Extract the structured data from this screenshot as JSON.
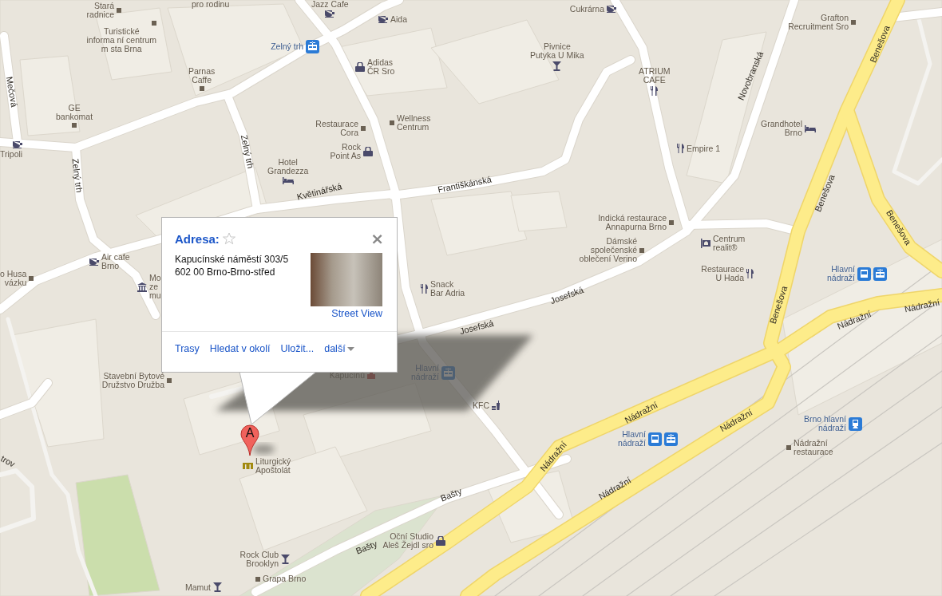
{
  "map": {
    "streets": [
      {
        "text": "Mečová"
      },
      {
        "text": "Zelný trh"
      },
      {
        "text": "Zelný trh"
      },
      {
        "text": "Květinářská"
      },
      {
        "text": "Františkánská"
      },
      {
        "text": "Novobranská"
      },
      {
        "text": "Benešova"
      },
      {
        "text": "Benešova"
      },
      {
        "text": "Benešova"
      },
      {
        "text": "Benešova"
      },
      {
        "text": "Josefská"
      },
      {
        "text": "Josefská"
      },
      {
        "text": "Nádražní"
      },
      {
        "text": "Nádražní"
      },
      {
        "text": "Nádražní"
      },
      {
        "text": "Nádražní"
      },
      {
        "text": "Nádražní"
      },
      {
        "text": "Nádražní"
      },
      {
        "text": "Bašty"
      },
      {
        "text": "Bašty"
      },
      {
        "text": "trov"
      }
    ],
    "places": [
      {
        "text": "Stará\nradnice",
        "kind": "square"
      },
      {
        "text": "Turistické\ninforma ní centrum\nm sta Brna",
        "kind": "square"
      },
      {
        "text": "pro rodinu",
        "kind": "none"
      },
      {
        "text": "Jazz Cafe",
        "kind": "cafe"
      },
      {
        "text": "Aida",
        "kind": "cafe"
      },
      {
        "text": "Cukrárna",
        "kind": "cafe"
      },
      {
        "text": "Grafton\nRecruitment Sro",
        "kind": "square"
      },
      {
        "text": "Zelný trh",
        "kind": "tram"
      },
      {
        "text": "Adidas\nČR Sro",
        "kind": "shop"
      },
      {
        "text": "Pivnice\nPutyka U Mika",
        "kind": "bar"
      },
      {
        "text": "Parnas\nCaffe",
        "kind": "square"
      },
      {
        "text": "ATRIUM\nCAFE",
        "kind": "restaurant"
      },
      {
        "text": "GE\nbankomat",
        "kind": "square"
      },
      {
        "text": "Wellness\nCentrum",
        "kind": "square"
      },
      {
        "text": "Restaurace\nCora",
        "kind": "square"
      },
      {
        "text": "Rock\nPoint As",
        "kind": "shop"
      },
      {
        "text": "Grandhotel\nBrno",
        "kind": "hotel"
      },
      {
        "text": "Empire 1",
        "kind": "restaurant"
      },
      {
        "text": "Tripoli",
        "kind": "cafe"
      },
      {
        "text": "Hotel\nGrandezza",
        "kind": "hotel"
      },
      {
        "text": "Indická restaurace\nAnnapurna Brno",
        "kind": "square"
      },
      {
        "text": "Dámské\nspolečenské\noblečení Verino",
        "kind": "square"
      },
      {
        "text": "Centrum\nrealit®",
        "kind": "realty"
      },
      {
        "text": "Restaurace\nU Hada",
        "kind": "restaurant"
      },
      {
        "text": "Hlavní\nnádraží",
        "kind": "bustram"
      },
      {
        "text": "Air cafe\nBrno",
        "kind": "cafe"
      },
      {
        "text": "o Husa\nvázku",
        "kind": "square"
      },
      {
        "text": "Mo\nze\nmu",
        "kind": "museum"
      },
      {
        "text": "Snack\nBar Adria",
        "kind": "restaurant"
      },
      {
        "text": "Stavební Bytové\nDružstvo Družba",
        "kind": "square"
      },
      {
        "text": "Kapucínů",
        "kind": "landmark"
      },
      {
        "text": "Hlavní\nnádraží",
        "kind": "tram"
      },
      {
        "text": "KFC",
        "kind": "fastfood"
      },
      {
        "text": "Brno hlavní\nnádraží",
        "kind": "train"
      },
      {
        "text": "Nádražní\nrestaurace",
        "kind": "square"
      },
      {
        "text": "Hlavní\nnádraží",
        "kind": "bustram"
      },
      {
        "text": "Liturgický\nApoštolát",
        "kind": "church"
      },
      {
        "text": "Oční Studio\nAleš Žejdl sro",
        "kind": "shop"
      },
      {
        "text": "Rock Club\nBrooklyn",
        "kind": "bar"
      },
      {
        "text": "Grapa Brno",
        "kind": "square"
      },
      {
        "text": "Mamut",
        "kind": "bar"
      }
    ],
    "marker": {
      "label": "A"
    }
  },
  "info_window": {
    "title": "Adresa:",
    "starred": false,
    "close": "×",
    "address": [
      "Kapucínské náměstí 303/5",
      "602 00 Brno-Brno-střed"
    ],
    "street_view_link": "Street View",
    "actions": [
      {
        "label": "Trasy",
        "kind": "link"
      },
      {
        "label": "Hledat v okolí",
        "kind": "link"
      },
      {
        "label": "Uložit...",
        "kind": "link"
      },
      {
        "label": "další",
        "kind": "menu"
      }
    ]
  }
}
